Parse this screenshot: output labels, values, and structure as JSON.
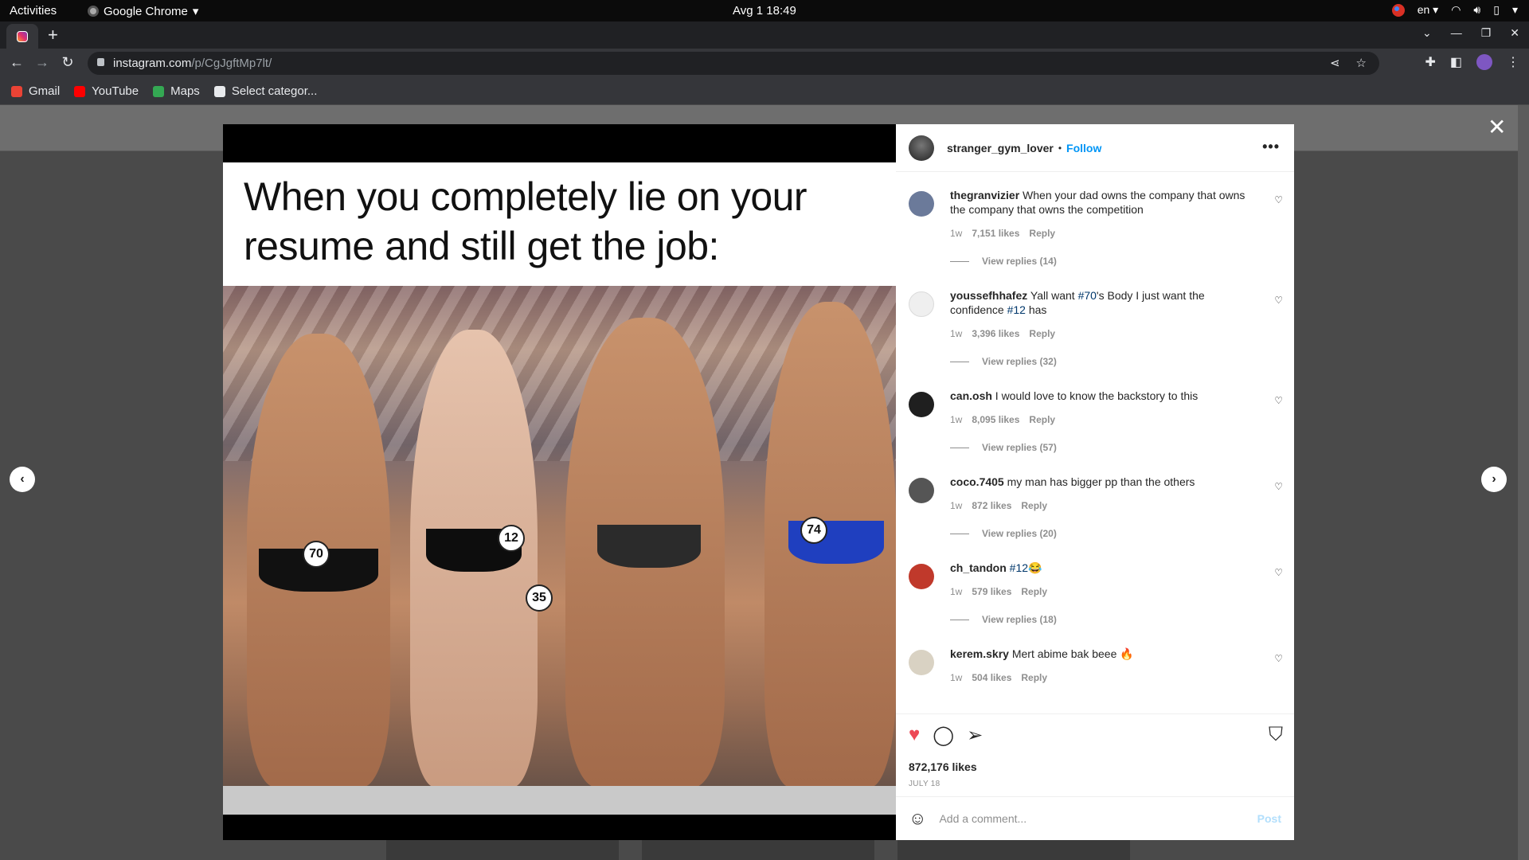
{
  "system_bar": {
    "activities": "Activities",
    "app_name": "Google Chrome",
    "clock": "Avg 1  18:49",
    "language": "en"
  },
  "browser": {
    "url_host": "instagram.com",
    "url_path": "/p/CgJgftMp7lt/",
    "bookmarks": [
      {
        "label": "Gmail",
        "icon": "gmail-icon",
        "color": "#ea4335"
      },
      {
        "label": "YouTube",
        "icon": "youtube-icon",
        "color": "#ff0000"
      },
      {
        "label": "Maps",
        "icon": "maps-icon",
        "color": "#34a853"
      },
      {
        "label": "Select categor...",
        "icon": "globe-icon",
        "color": "#e8eaed"
      }
    ]
  },
  "post": {
    "meme_text": [
      "When you completely lie on your",
      "resume and still get the job:"
    ],
    "number_tags": [
      "70",
      "12",
      "35",
      "74"
    ],
    "owner": "stranger_gym_lover",
    "separator": "•",
    "follow_label": "Follow",
    "likes": "872,176 likes",
    "date": "JULY 18",
    "comment_placeholder": "Add a comment...",
    "post_label": "Post"
  },
  "comments": [
    {
      "user": "thegranvizier",
      "text": "When your dad owns the company that owns the company that owns the competition",
      "time": "1w",
      "likes": "7,151 likes",
      "reply": "Reply",
      "replies": "View replies (14)",
      "avatar_color": "#6b7a9a"
    },
    {
      "user": "youssefhhafez",
      "text_parts": [
        "Yall want ",
        "#70",
        "'s Body I just want the confidence ",
        "#12",
        " has"
      ],
      "time": "1w",
      "likes": "3,396 likes",
      "reply": "Reply",
      "replies": "View replies (32)",
      "avatar_color": "#efefef"
    },
    {
      "user": "can.osh",
      "text": "I would love to know the backstory to this",
      "time": "1w",
      "likes": "8,095 likes",
      "reply": "Reply",
      "replies": "View replies (57)",
      "avatar_color": "#1f1f1f"
    },
    {
      "user": "coco.7405",
      "text": "my man has bigger pp than the others",
      "time": "1w",
      "likes": "872 likes",
      "reply": "Reply",
      "replies": "View replies (20)",
      "avatar_color": "#555555"
    },
    {
      "user": "ch_tandon",
      "tag": "#12",
      "emoji": "😂",
      "time": "1w",
      "likes": "579 likes",
      "reply": "Reply",
      "replies": "View replies (18)",
      "avatar_color": "#c0392b"
    },
    {
      "user": "kerem.skry",
      "text": "Mert abime bak beee 🔥",
      "time": "1w",
      "likes": "504 likes",
      "reply": "Reply",
      "avatar_color": "#d9d2c3"
    }
  ]
}
